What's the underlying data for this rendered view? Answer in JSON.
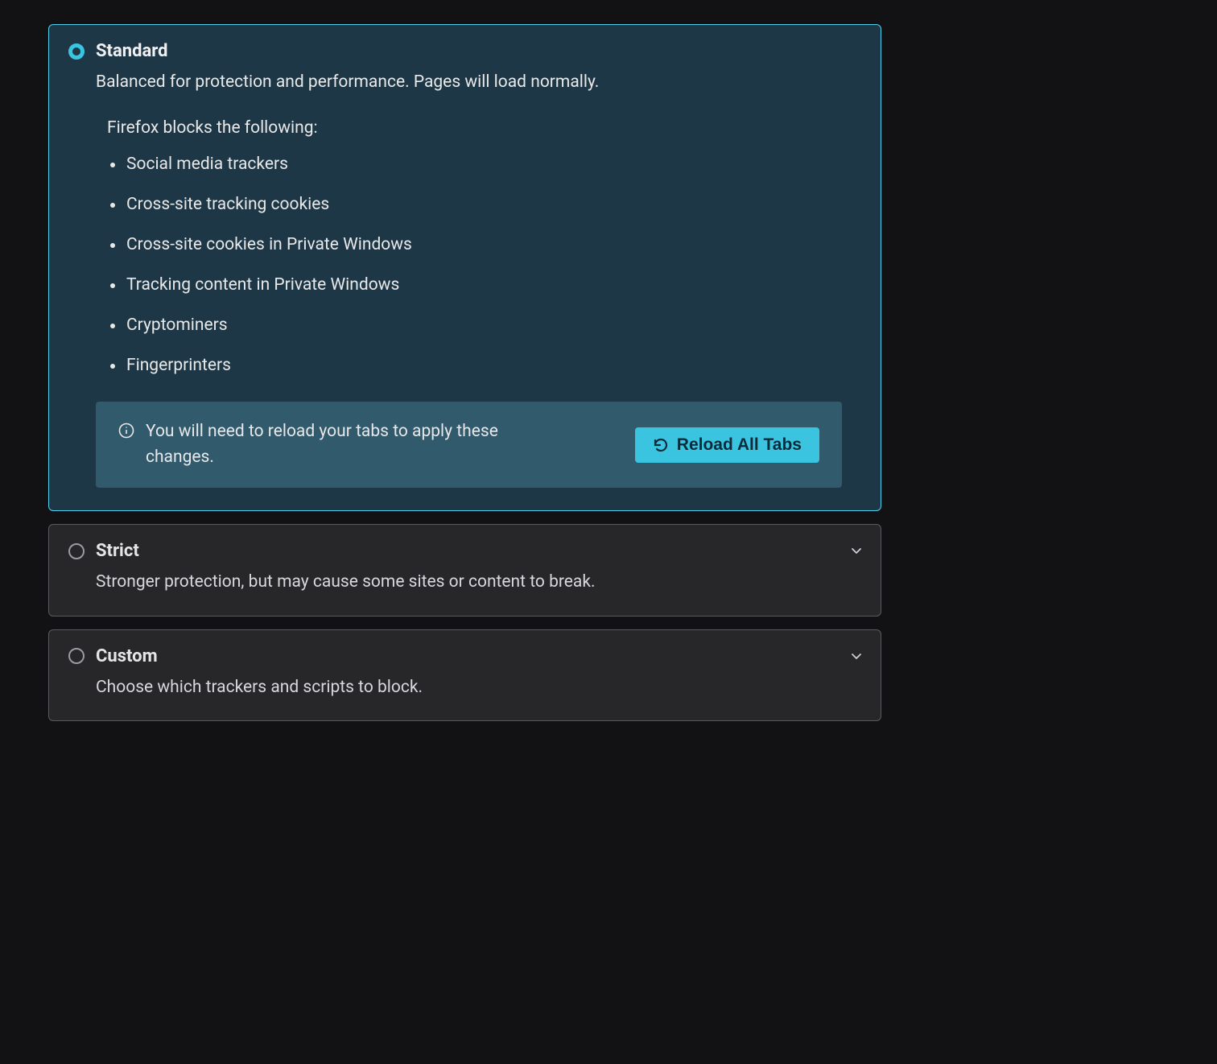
{
  "options": {
    "standard": {
      "title": "Standard",
      "description": "Balanced for protection and performance. Pages will load normally.",
      "blocks_intro": "Firefox blocks the following:",
      "blocks": [
        "Social media trackers",
        "Cross-site tracking cookies",
        "Cross-site cookies in Private Windows",
        "Tracking content in Private Windows",
        "Cryptominers",
        "Fingerprinters"
      ],
      "reload_notice": "You will need to reload your tabs to apply these changes.",
      "reload_button": "Reload All Tabs"
    },
    "strict": {
      "title": "Strict",
      "description": "Stronger protection, but may cause some sites or content to break."
    },
    "custom": {
      "title": "Custom",
      "description": "Choose which trackers and scripts to block."
    }
  }
}
